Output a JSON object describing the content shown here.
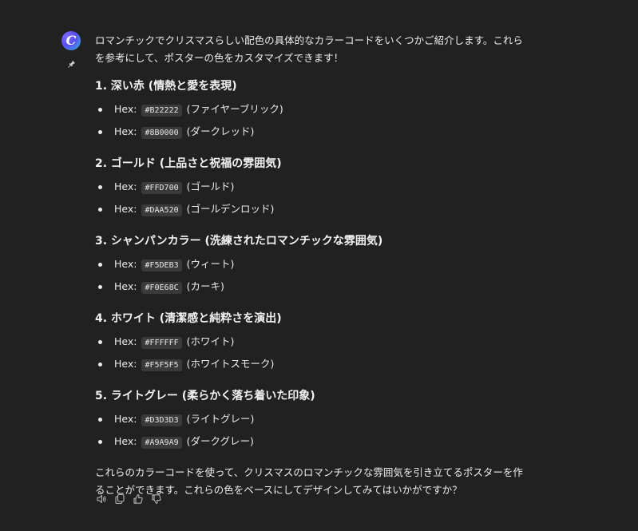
{
  "assistant": {
    "avatar_letter": "C",
    "intro": "ロマンチックでクリスマスらしい配色の具体的なカラーコードをいくつかご紹介します。これらを参考にして、ポスターの色をカスタマイズできます！",
    "sections": [
      {
        "title": "1. 深い赤 (情熱と愛を表現)",
        "items": [
          {
            "prefix": "Hex:",
            "code": "#B22222",
            "label": "(ファイヤーブリック)"
          },
          {
            "prefix": "Hex:",
            "code": "#8B0000",
            "label": "(ダークレッド)"
          }
        ]
      },
      {
        "title": "2. ゴールド (上品さと祝福の雰囲気)",
        "items": [
          {
            "prefix": "Hex:",
            "code": "#FFD700",
            "label": "(ゴールド)"
          },
          {
            "prefix": "Hex:",
            "code": "#DAA520",
            "label": "(ゴールデンロッド)"
          }
        ]
      },
      {
        "title": "3. シャンパンカラー (洗練されたロマンチックな雰囲気)",
        "items": [
          {
            "prefix": "Hex:",
            "code": "#F5DEB3",
            "label": "(ウィート)"
          },
          {
            "prefix": "Hex:",
            "code": "#F0E68C",
            "label": "(カーキ)"
          }
        ]
      },
      {
        "title": "4. ホワイト (清潔感と純粋さを演出)",
        "items": [
          {
            "prefix": "Hex:",
            "code": "#FFFFFF",
            "label": "(ホワイト)"
          },
          {
            "prefix": "Hex:",
            "code": "#F5F5F5",
            "label": "(ホワイトスモーク)"
          }
        ]
      },
      {
        "title": "5. ライトグレー (柔らかく落ち着いた印象)",
        "items": [
          {
            "prefix": "Hex:",
            "code": "#D3D3D3",
            "label": "(ライトグレー)"
          },
          {
            "prefix": "Hex:",
            "code": "#A9A9A9",
            "label": "(ダークグレー)"
          }
        ]
      }
    ],
    "outro": "これらのカラーコードを使って、クリスマスのロマンチックな雰囲気を引き立てるポスターを作ることができます。これらの色をベースにしてデザインしてみてはいかがですか？"
  },
  "actions": [
    {
      "name": "read-aloud-icon"
    },
    {
      "name": "copy-icon"
    },
    {
      "name": "thumbs-up-icon"
    },
    {
      "name": "thumbs-down-icon"
    }
  ],
  "colors": {
    "background": "#212121",
    "text": "#ececec",
    "code_background": "#3a3a3a",
    "icon": "#b4b4b4"
  }
}
